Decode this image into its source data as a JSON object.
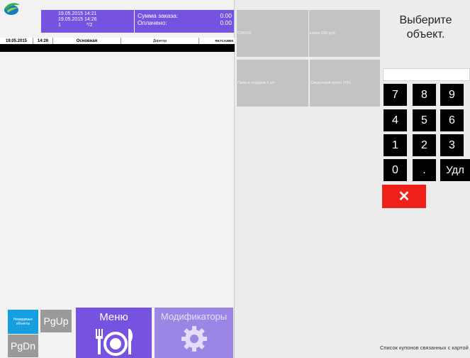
{
  "order": {
    "open_datetime": "19.05.2015 14:21",
    "close_datetime": "19.05.2015 14:26",
    "guests": "1",
    "table": "*/2",
    "sum_label": "Сумма заказа:",
    "sum_value": "0.00",
    "paid_label": "Оплачено:",
    "paid_value": "0.00"
  },
  "header_row": {
    "date": "19.05.2015",
    "time": "14:26",
    "menu": "Основная",
    "waiter": "Диретор",
    "terminal": "RK7CA3900"
  },
  "bottom_buttons": {
    "invisible": "Невидимые объекты",
    "pgup": "PgUp",
    "pgdn": "PgDn",
    "menu": "Меню",
    "modifiers": "Модификаторы"
  },
  "coupons": [
    {
      "label": "CARDS"
    },
    {
      "label": "купон 500 руб."
    },
    {
      "label": "Пиво в подарок 2 шт"
    },
    {
      "label": "Скидочный купон 20%"
    }
  ],
  "prompt": "Выберите объект.",
  "number_input": "",
  "keypad": [
    "7",
    "8",
    "9",
    "4",
    "5",
    "6",
    "1",
    "2",
    "3",
    "0",
    ".",
    "Удл"
  ],
  "cancel_symbol": "✕",
  "footer_note": "Список купонов связанных с картой",
  "colors": {
    "accent": "#7553e0",
    "accent_light": "#9b86e6",
    "blue_button": "#169fe0",
    "gray_button": "#9a9a9a",
    "cancel": "#f0201a",
    "key": "#000000"
  }
}
